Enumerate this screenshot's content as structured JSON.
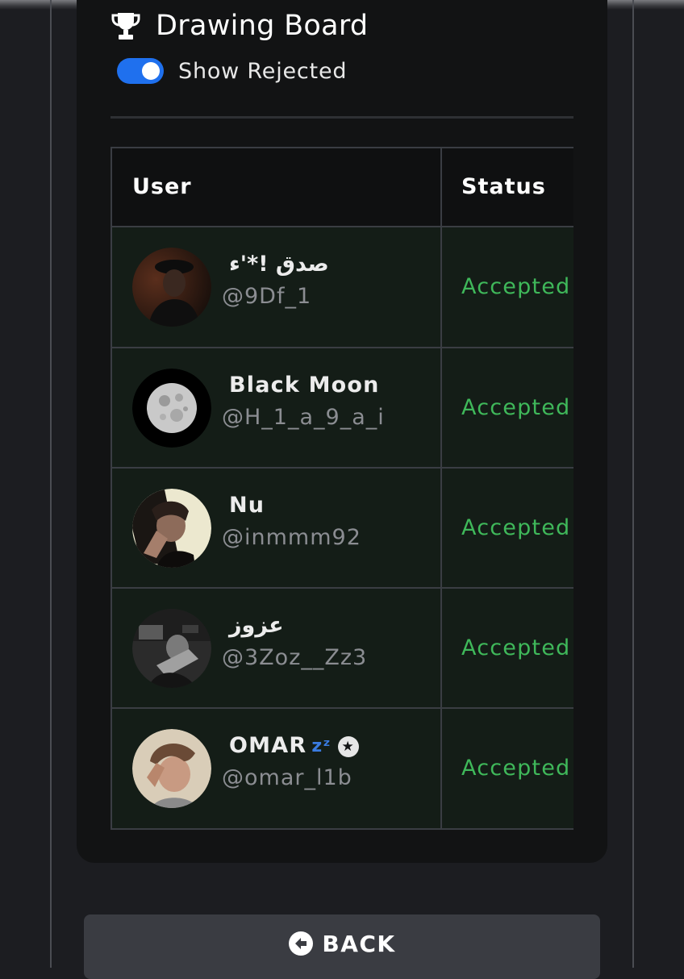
{
  "board": {
    "title": "Drawing Board",
    "title_icon": "trophy-icon"
  },
  "filter": {
    "show_rejected_label": "Show Rejected",
    "show_rejected_enabled": true,
    "toggle_color": "#1f70ee"
  },
  "table": {
    "headers": {
      "user": "User",
      "status": "Status"
    },
    "rows": [
      {
        "name": "صدق !*'ء",
        "handle": "@9Df_1",
        "status": "Accepted"
      },
      {
        "name": "Black Moon",
        "handle": "@H_1_a_9_a_i",
        "status": "Accepted"
      },
      {
        "name": "Nu",
        "handle": "@inmmm92",
        "status": "Accepted"
      },
      {
        "name": "عزوز",
        "handle": "@3Zoz__Zz3",
        "status": "Accepted"
      },
      {
        "name": "OMAR",
        "name_suffix": "zᶻ",
        "handle": "@omar_l1b",
        "status": "Accepted"
      }
    ],
    "status_color": "#3fb85a"
  },
  "footer": {
    "back_label": "BACK",
    "back_icon": "arrow-left-circle-icon"
  }
}
